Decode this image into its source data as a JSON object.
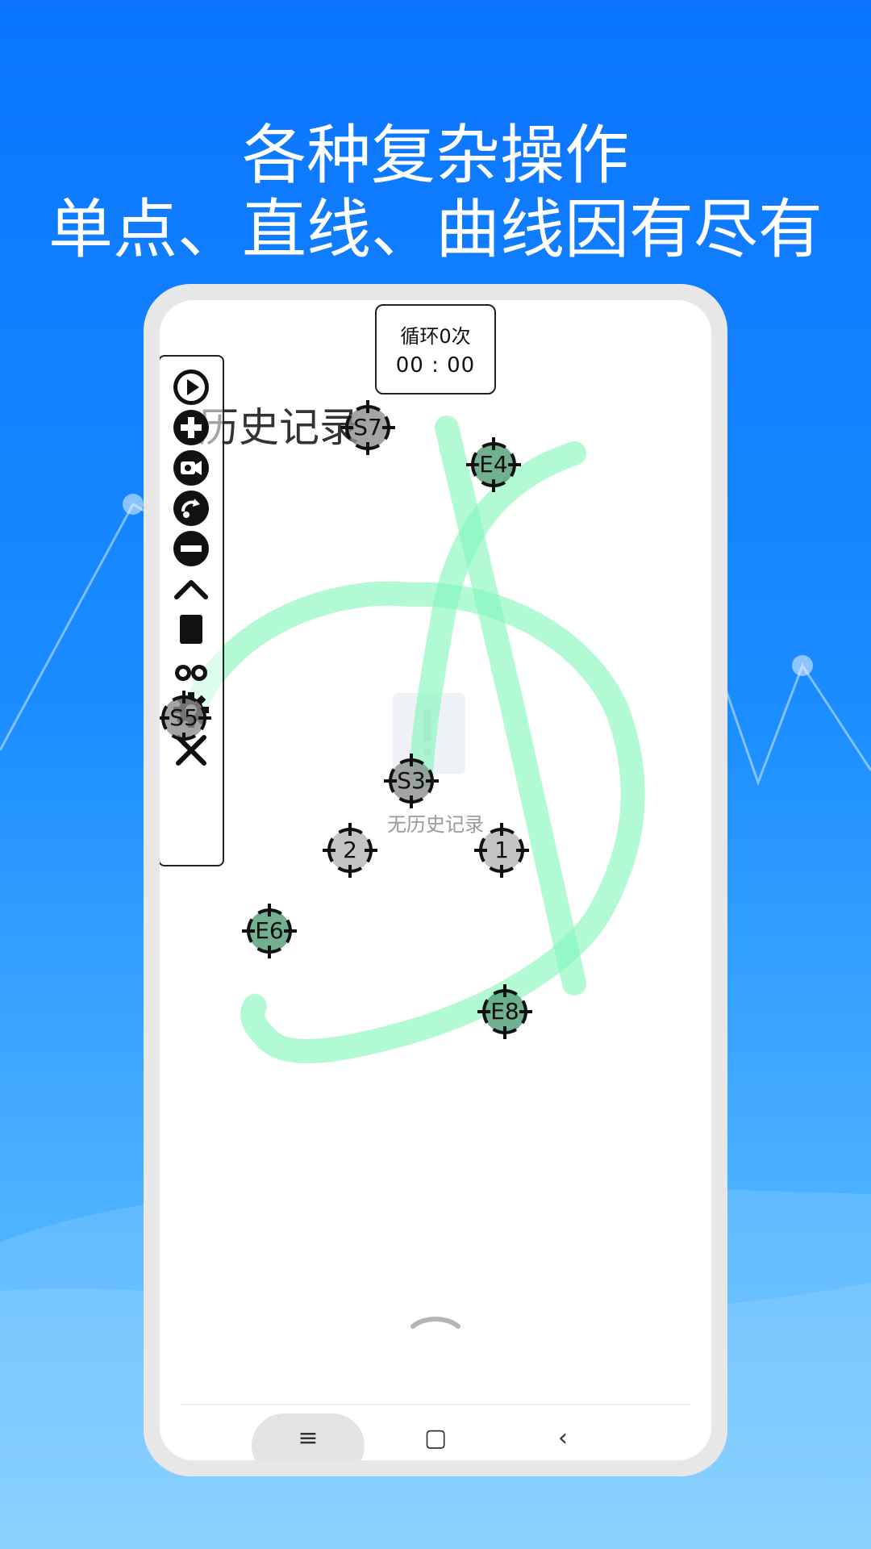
{
  "headline": {
    "line1": "各种复杂操作",
    "line2": "单点、直线、曲线因有尽有"
  },
  "loop_counter": {
    "label": "循环0次",
    "time": "00 : 00"
  },
  "history": {
    "title": "历史记录",
    "empty_text": "无历史记录"
  },
  "toolbar": {
    "items": [
      {
        "icon": "play-icon"
      },
      {
        "icon": "plus-icon"
      },
      {
        "icon": "record-icon"
      },
      {
        "icon": "swipe-icon"
      },
      {
        "icon": "minus-icon"
      },
      {
        "icon": "chevron-up-icon"
      },
      {
        "icon": "save-icon"
      },
      {
        "icon": "glasses-icon"
      },
      {
        "icon": "gear-icon"
      },
      {
        "icon": "close-icon"
      }
    ]
  },
  "targets": {
    "s7": "S7",
    "e4": "E4",
    "s5": "S5",
    "s3": "S3",
    "t2": "2",
    "t1": "1",
    "e6": "E6",
    "e8": "E8"
  },
  "nav": {
    "menu": "≡",
    "home": "▢",
    "back": "‹"
  },
  "colors": {
    "path": "#7ef7b8",
    "accent": "#0a74ff"
  }
}
